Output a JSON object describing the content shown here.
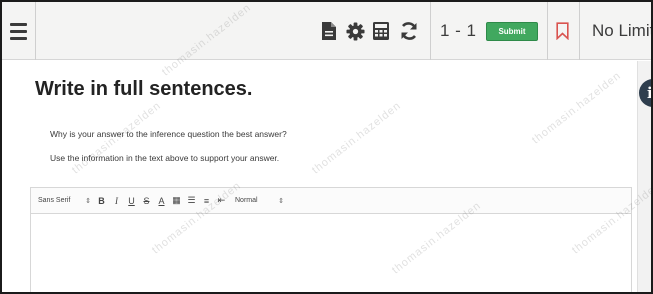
{
  "toolbar": {
    "question_range": "1 - 1",
    "submit_label": "Submit",
    "time_limit": "No Limit",
    "icons": [
      "menu-icon",
      "document-icon",
      "gear-icon",
      "calculator-icon",
      "refresh-icon",
      "bookmark-icon"
    ]
  },
  "content": {
    "title": "Write in full sentences.",
    "prompt_line1": "Why is your answer to the inference question the best answer?",
    "prompt_line2": "Use the information in the text above to support your answer.",
    "info_glyph": "i"
  },
  "editor": {
    "font_select": "Sans Serif",
    "size_select": "Normal",
    "value": ""
  },
  "watermark_text": "thomasin.hazelden",
  "colors": {
    "submit_green": "#41a85f",
    "bookmark_red": "#d9534f",
    "toolbar_bg": "#f4f4f3",
    "icon_dark": "#3a3a3a"
  }
}
